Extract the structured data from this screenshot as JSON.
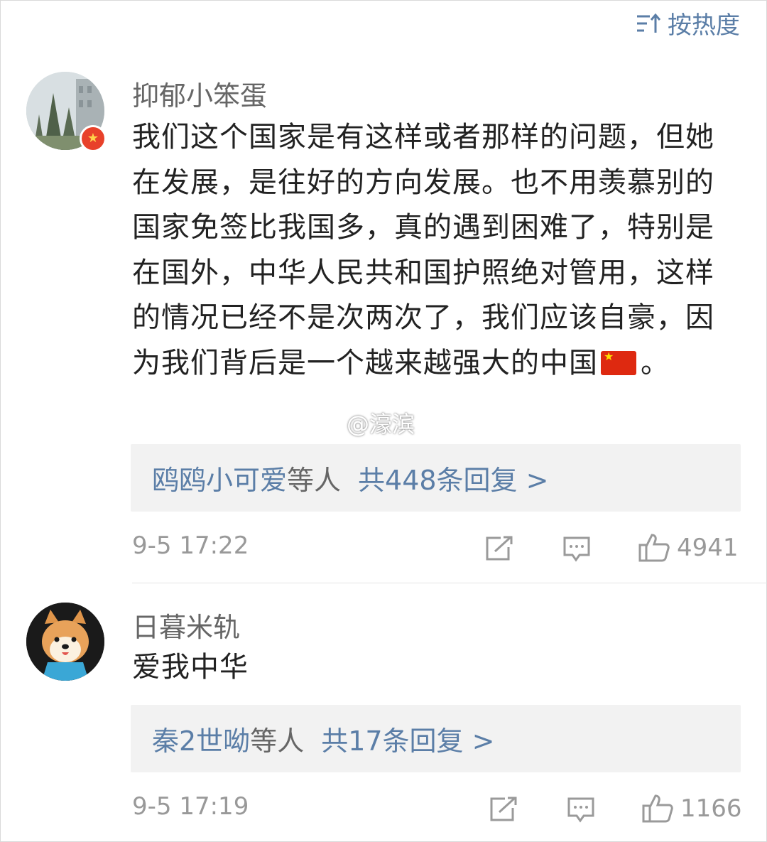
{
  "sort": {
    "label": "按热度",
    "icon": "sort-icon"
  },
  "watermark": "@濠滨",
  "comments": [
    {
      "username": "抑郁小笨蛋",
      "text": "我们这个国家是有这样或者那样的问题，但她在发展，是往好的方向发展。也不用羡慕别的国家免签比我国多，真的遇到困难了，特别是在国外，中华人民共和国护照绝对管用，这样的情况已经不是次两次了，我们应该自豪，因为我们背后是一个越来越强大的中国",
      "text_suffix": "。",
      "reply_names": "鸥鸥小可爱",
      "reply_etc": "等人",
      "reply_total": "共448条回复 >",
      "time": "9-5 17:22",
      "likes": "4941"
    },
    {
      "username": "日暮米轨",
      "text": "爱我中华",
      "reply_names": "秦2世呦",
      "reply_etc": "等人",
      "reply_total": "共17条回复 >",
      "time": "9-5 17:19",
      "likes": "1166"
    }
  ],
  "colors": {
    "link": "#5b7ea7",
    "meta": "#999999",
    "reply_bg": "#f2f2f2",
    "badge": "#e8412a"
  }
}
